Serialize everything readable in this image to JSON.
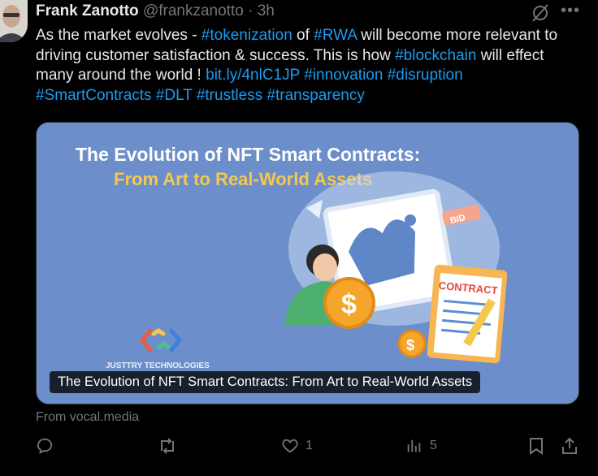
{
  "post": {
    "author_name": "Frank Zanotto",
    "author_handle": "@frankzanotto",
    "separator": "·",
    "time": "3h",
    "text_segments": [
      {
        "text": "As the market evolves - ",
        "kind": "text"
      },
      {
        "text": "#tokenization",
        "kind": "link"
      },
      {
        "text": " of ",
        "kind": "text"
      },
      {
        "text": "#RWA",
        "kind": "link"
      },
      {
        "text": " will become more relevant to driving customer satisfaction & success. This is how ",
        "kind": "text"
      },
      {
        "text": "#blockchain",
        "kind": "link"
      },
      {
        "text": " will effect many around the world ! ",
        "kind": "text"
      },
      {
        "text": "bit.ly/4nlC1JP",
        "kind": "link"
      },
      {
        "text": " ",
        "kind": "text"
      },
      {
        "text": "#innovation",
        "kind": "link"
      },
      {
        "text": " ",
        "kind": "text"
      },
      {
        "text": "#disruption",
        "kind": "link"
      },
      {
        "text": " ",
        "kind": "text"
      },
      {
        "text": "#SmartContracts",
        "kind": "link"
      },
      {
        "text": " ",
        "kind": "text"
      },
      {
        "text": "#DLT",
        "kind": "link"
      },
      {
        "text": " ",
        "kind": "text"
      },
      {
        "text": "#trustless",
        "kind": "link"
      },
      {
        "text": " ",
        "kind": "text"
      },
      {
        "text": "#transparency",
        "kind": "link"
      }
    ],
    "more_icon": "more-horizontal-icon",
    "grok_icon": "grok-icon"
  },
  "card": {
    "image_title_line1": "The Evolution of NFT Smart Contracts:",
    "image_title_line2": "From Art to Real-World Assets",
    "image_contract_label": "CONTRACT",
    "image_bid_label": "BID",
    "image_brand": "JUSTTRY TECHNOLOGIES",
    "caption": "The Evolution of NFT Smart Contracts: From Art to Real-World Assets",
    "source": "From vocal.media"
  },
  "actions": {
    "reply_count": "",
    "repost_count": "",
    "like_count": "1",
    "views_count": "5"
  },
  "colors": {
    "background": "#000000",
    "text": "#e7e9ea",
    "muted": "#71767b",
    "link": "#1d9bf0",
    "card_bg": "#6c8fcb",
    "title_white": "#ffffff",
    "title_yellow": "#f5c84c"
  }
}
